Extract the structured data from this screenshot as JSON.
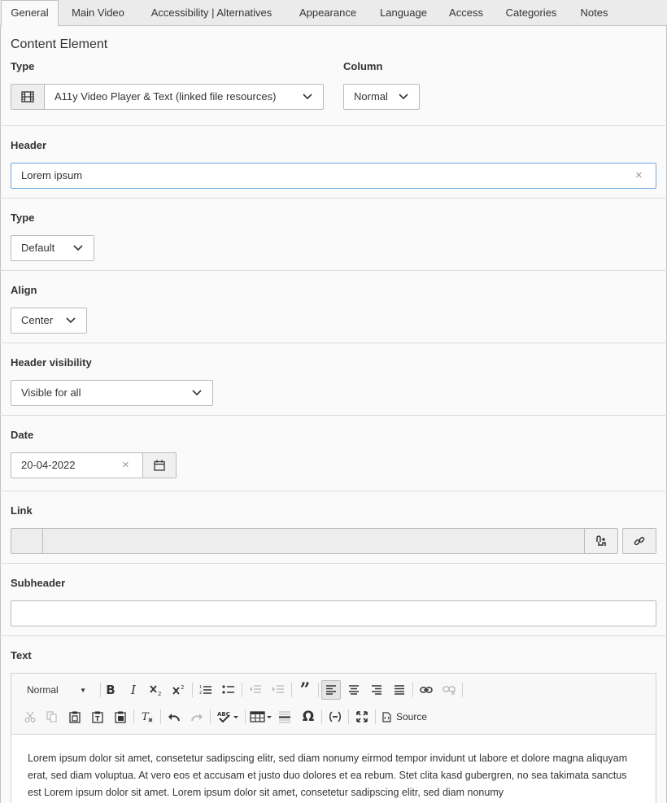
{
  "tabs": [
    {
      "label": "General",
      "active": true
    },
    {
      "label": "Main Video"
    },
    {
      "label": "Accessibility | Alternatives"
    },
    {
      "label": "Appearance"
    },
    {
      "label": "Language"
    },
    {
      "label": "Access"
    },
    {
      "label": "Categories"
    },
    {
      "label": "Notes"
    }
  ],
  "content_element": {
    "title": "Content Element",
    "type_label": "Type",
    "type_value": "A11y Video Player & Text (linked file resources)",
    "column_label": "Column",
    "column_value": "Normal"
  },
  "header": {
    "label": "Header",
    "value": "Lorem ipsum",
    "clear": "×"
  },
  "header_type": {
    "label": "Type",
    "value": "Default"
  },
  "align": {
    "label": "Align",
    "value": "Center"
  },
  "header_visibility": {
    "label": "Header visibility",
    "value": "Visible for all"
  },
  "date": {
    "label": "Date",
    "value": "20-04-2022",
    "clear": "×"
  },
  "link": {
    "label": "Link",
    "value": ""
  },
  "subheader": {
    "label": "Subheader",
    "value": ""
  },
  "text": {
    "label": "Text",
    "format": "Normal",
    "source_label": "Source",
    "content": "Lorem ipsum dolor sit amet, consetetur sadipscing elitr, sed diam nonumy eirmod tempor invidunt ut labore et dolore magna aliquyam erat, sed diam voluptua. At vero eos et accusam et justo duo dolores et ea rebum. Stet clita kasd gubergren, no sea takimata sanctus est Lorem ipsum dolor sit amet. Lorem ipsum dolor sit amet, consetetur sadipscing elitr, sed diam nonumy"
  },
  "colors": {
    "focus_border": "#6daae0",
    "tab_bar": "#ebebeb",
    "panel_bg": "#fafafa"
  }
}
